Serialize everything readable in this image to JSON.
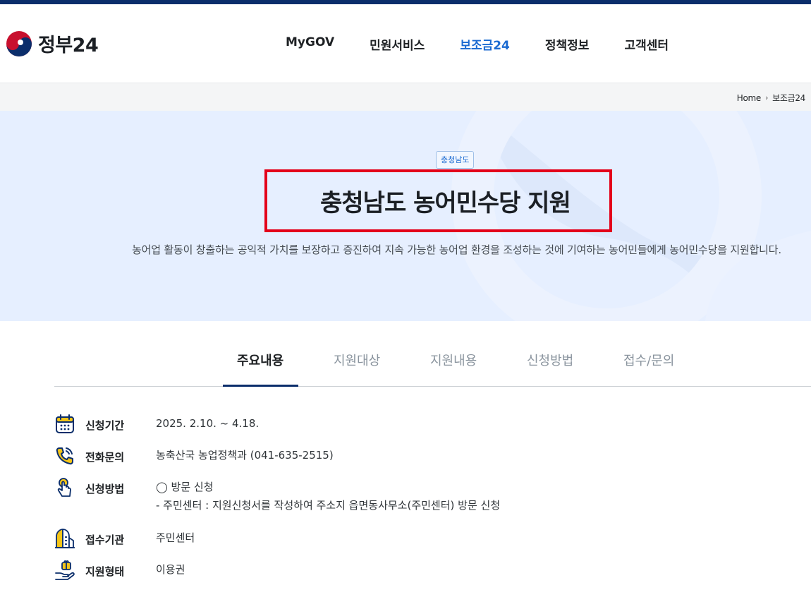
{
  "header": {
    "logo_text": "정부24",
    "nav": [
      {
        "label": "MyGOV"
      },
      {
        "label": "민원서비스"
      },
      {
        "label": "보조금24"
      },
      {
        "label": "정책정보"
      },
      {
        "label": "고객센터"
      }
    ],
    "active_nav": "보조금24"
  },
  "breadcrumb": {
    "home": "Home",
    "current": "보조금24"
  },
  "hero": {
    "region_badge": "충청남도",
    "title": "충청남도 농어민수당 지원",
    "description": "농어업 활동이 창출하는 공익적 가치를 보장하고 증진하여 지속 가능한 농어업 환경을 조성하는 것에 기여하는 농어민들에게 농어민수당을 지원합니다."
  },
  "tabs": [
    {
      "label": "주요내용"
    },
    {
      "label": "지원대상"
    },
    {
      "label": "지원내용"
    },
    {
      "label": "신청방법"
    },
    {
      "label": "접수/문의"
    }
  ],
  "details": {
    "period": {
      "label": "신청기간",
      "value": "2025. 2.10. ~ 4.18.",
      "icon": "calendar-icon"
    },
    "phone": {
      "label": "전화문의",
      "value": "농축산국 농업정책과 (041-635-2515)",
      "icon": "phone-icon"
    },
    "method": {
      "label": "신청방법",
      "value_line1": "◯ 방문 신청",
      "value_line2": "- 주민센터 : 지원신청서를 작성하여 주소지 읍면동사무소(주민센터) 방문 신청",
      "icon": "hand-pointer-icon"
    },
    "office": {
      "label": "접수기관",
      "value": "주민센터",
      "icon": "building-icon"
    },
    "type": {
      "label": "지원형태",
      "value": "이용권",
      "icon": "hand-gift-icon"
    }
  },
  "colors": {
    "brand_navy": "#0b2e6b",
    "accent_blue": "#1a6ad1",
    "highlight_red": "#e3001b",
    "hero_bg": "#e6efff",
    "icon_yellow": "#f5c518"
  }
}
